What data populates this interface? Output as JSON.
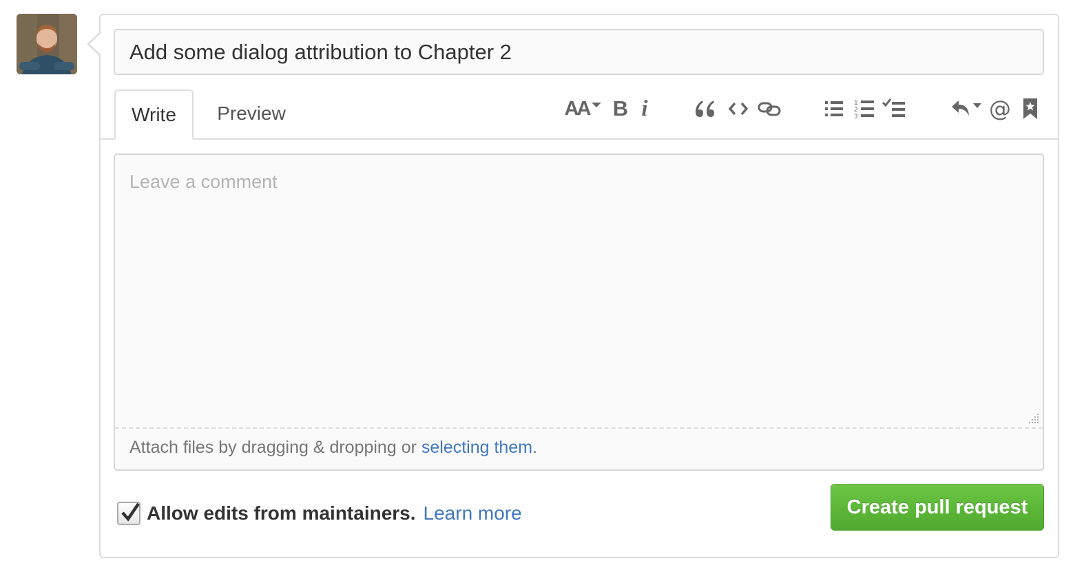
{
  "user": {
    "avatar_icon": "user-avatar"
  },
  "pr_form": {
    "title_value": "Add some dialog attribution to Chapter 2",
    "tabs": [
      {
        "label": "Write",
        "active": true
      },
      {
        "label": "Preview",
        "active": false
      }
    ],
    "toolbar": {
      "icons": [
        "text-size-icon",
        "bold-icon",
        "italic-icon",
        "quote-icon",
        "code-icon",
        "link-icon",
        "bulleted-list-icon",
        "numbered-list-icon",
        "task-list-icon",
        "saved-replies-icon",
        "mention-icon",
        "reference-icon"
      ],
      "bold_label": "B",
      "italic_label": "i",
      "mention_label": "@",
      "text_size_label": "AA"
    },
    "comment": {
      "placeholder": "Leave a comment",
      "value": ""
    },
    "attach": {
      "prefix": "Attach files by dragging & dropping or ",
      "link_text": "selecting them",
      "suffix": "."
    },
    "allow_edits": {
      "checked": true,
      "label": "Allow edits from maintainers.",
      "learn_more": "Learn more"
    },
    "submit_label": "Create pull request"
  },
  "colors": {
    "accent_link": "#4078c0",
    "button_green": "#6cc644",
    "border": "#dddddd"
  }
}
